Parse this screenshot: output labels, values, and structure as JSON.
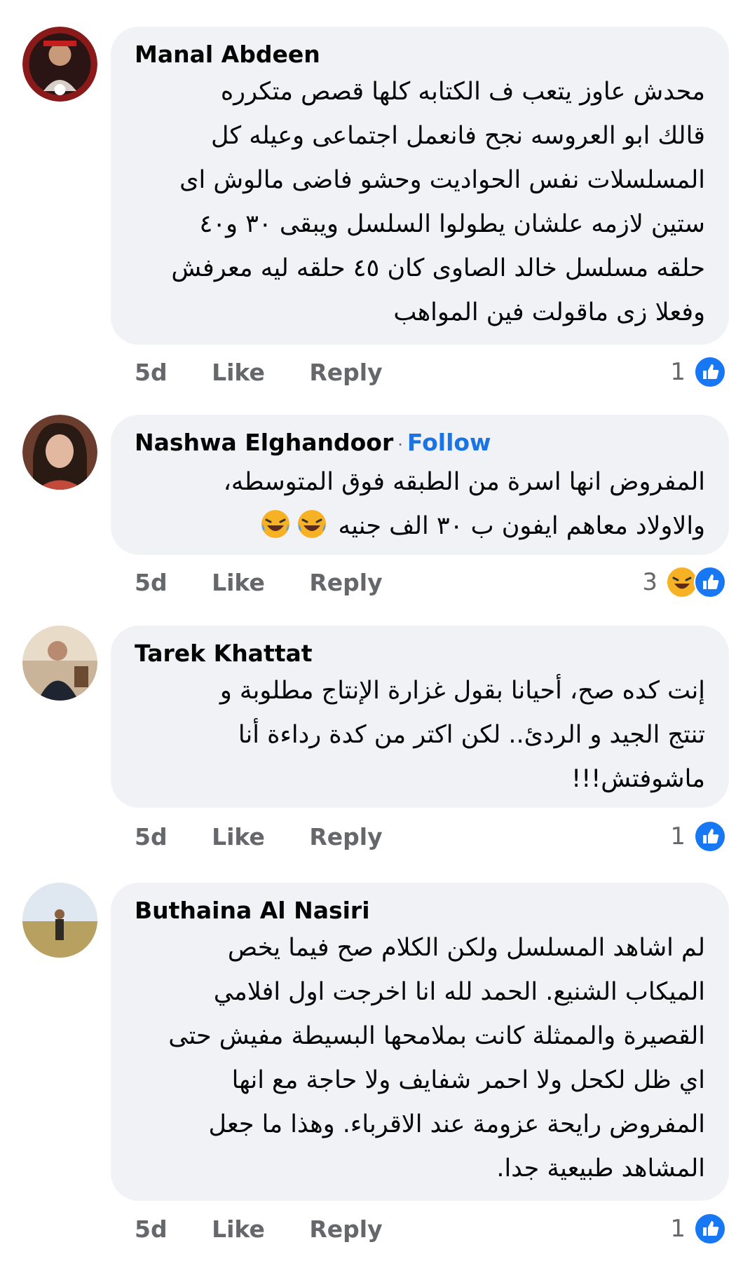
{
  "comments": [
    {
      "author": "Manal Abdeen",
      "follow": "",
      "lines": [
        "محدش عاوز يتعب ف  الكتابه كلها قصص متكرره",
        "قالك ابو العروسه نجح فانعمل اجتماعى وعيله كل",
        "المسلسلات نفس الحواديت وحشو فاضى مالوش اى",
        "ستين لازمه علشان يطولوا السلسل ويبقى ٣٠ و٤٠",
        "حلقه مسلسل خالد الصاوى كان ٤٥ حلقه ليه معرفش",
        "وفعلا زى ماقولت فين المواهب"
      ],
      "time": "5d",
      "like": "Like",
      "reply": "Reply",
      "reaction_count": "1",
      "reactions": [
        "like-icon"
      ]
    },
    {
      "author": "Nashwa Elghandoor",
      "follow": "Follow",
      "lines": [
        "المفروض انها اسرة من الطبقه فوق المتوسطه،",
        "والاولاد معاهم ايفون ب ٣٠ الف جنيه"
      ],
      "trailing_emoji": [
        "laughing-tears-emoji",
        "laughing-tears-emoji"
      ],
      "time": "5d",
      "like": "Like",
      "reply": "Reply",
      "reaction_count": "3",
      "reactions": [
        "haha-icon",
        "like-icon"
      ]
    },
    {
      "author": "Tarek Khattat",
      "follow": "",
      "lines": [
        "إنت كده صح، أحيانا بقول غزارة الإنتاج مطلوبة و",
        "تنتج الجيد و الردئ.. لكن اكتر من كدة رداءة أنا",
        "ماشوفتش!!!"
      ],
      "time": "5d",
      "like": "Like",
      "reply": "Reply",
      "reaction_count": "1",
      "reactions": [
        "like-icon"
      ]
    },
    {
      "author": "Buthaina Al Nasiri",
      "follow": "",
      "lines": [
        "لم اشاهد المسلسل ولكن الكلام صح فيما يخص",
        "الميكاب الشنيع. الحمد لله انا اخرجت اول افلامي",
        "القصيرة والممثلة كانت بملامحها البسيطة مفيش حتى",
        "اي ظل لكحل ولا احمر شفايف ولا حاجة مع انها",
        "المفروض رايحة عزومة عند الاقرباء. وهذا  ما جعل",
        "المشاهد طبيعية جدا."
      ],
      "time": "5d",
      "like": "Like",
      "reply": "Reply",
      "reaction_count": "1",
      "reactions": [
        "like-icon"
      ]
    }
  ],
  "colors": {
    "bubble": "#f0f2f5",
    "link": "#1b74e4",
    "meta": "#65676b",
    "like_blue": "#1877f2",
    "haha_yellow": "#f7b125"
  }
}
